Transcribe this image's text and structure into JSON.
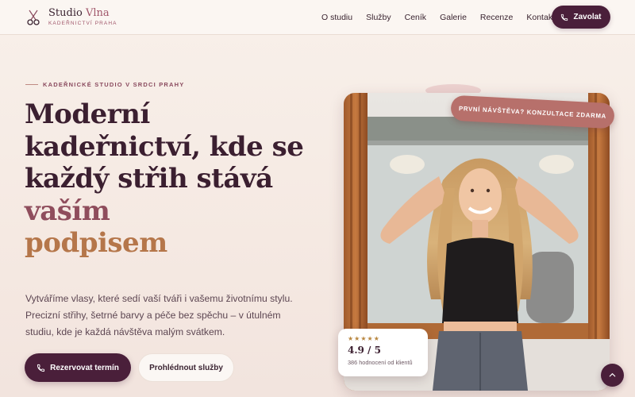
{
  "brand": {
    "name_main": "Studio ",
    "name_accent": "Vlna",
    "tagline": "KADEŘNICTVÍ PRAHA",
    "logo_icon": "scissors-icon"
  },
  "nav": {
    "items": [
      "O studiu",
      "Služby",
      "Ceník",
      "Galerie",
      "Recenze",
      "Kontakt"
    ],
    "call_label": "Zavolat",
    "call_icon": "phone-icon"
  },
  "hero": {
    "eyebrow": "KADEŘNICKÉ STUDIO V SRDCI PRAHY",
    "headline_part1": "Moderní kadeřnictví, kde se každý střih stává ",
    "headline_accent": "vaším",
    "headline_gold": "podpisem",
    "lede": "Vytváříme vlasy, které sedí vaší tváři i vašemu životnímu stylu. Precizní střihy, šetrné barvy a péče bez spěchu – v útulném studiu, kde je každá návštěva malým svátkem.",
    "primary_button": "Rezervovat termín",
    "secondary_button": "Prohlédnout služby",
    "badge": "PRVNÍ NÁVŠTĚVA? KONZULTACE ZDARMA"
  },
  "rating": {
    "stars": "★★★★★",
    "score": "4.9 / 5",
    "reviews": "386 hodnocení od klientů"
  },
  "colors": {
    "primary": "#4a1f3a",
    "rose": "#8f4d5c",
    "gold": "#b5764a",
    "badge": "#b7706b",
    "background": "#f8f0ea"
  }
}
